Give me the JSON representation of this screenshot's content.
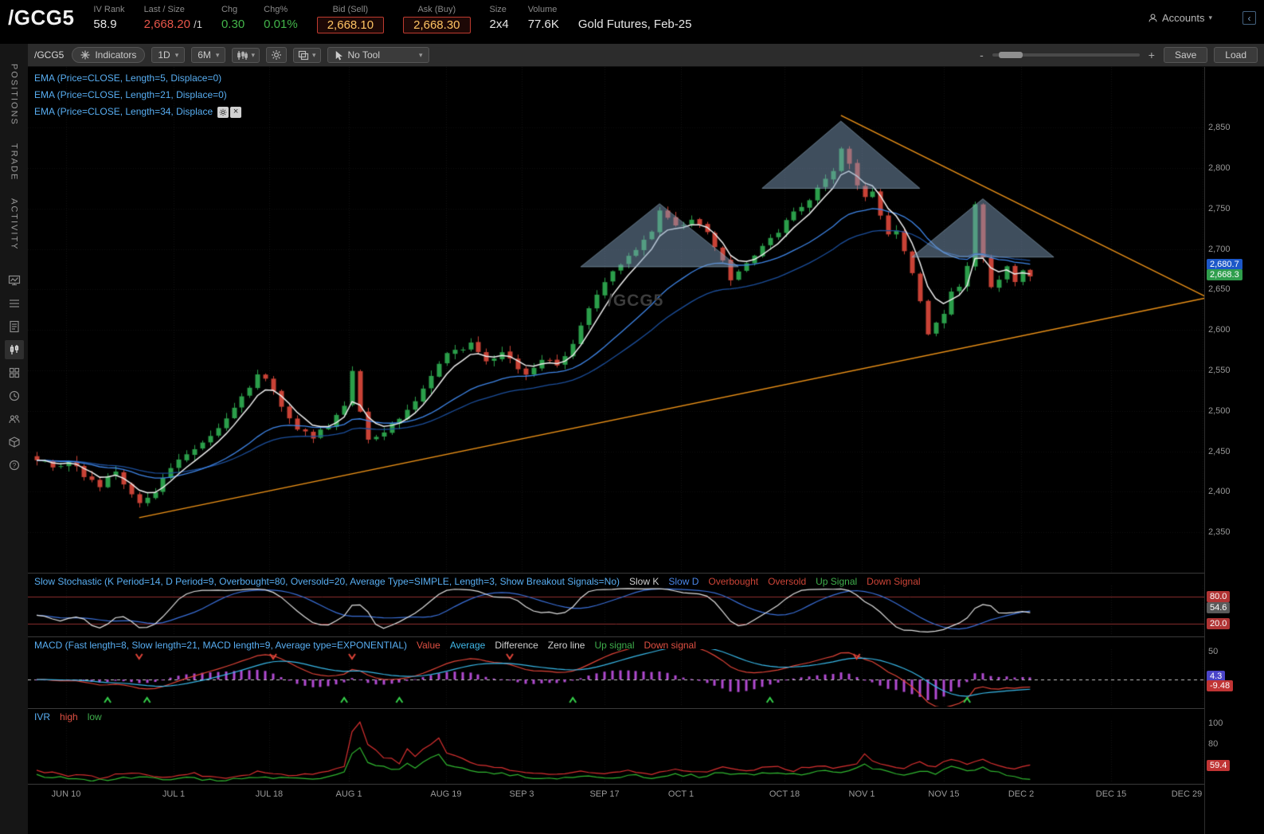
{
  "ui": {
    "caret": "▾",
    "collapse": "‹",
    "close": "×"
  },
  "header": {
    "symbol": "/GCG5",
    "iv_rank": {
      "label": "IV Rank",
      "value": "58.9"
    },
    "last_size": {
      "label": "Last / Size",
      "value": "2,668.20",
      "size": "/1"
    },
    "chg": {
      "label": "Chg",
      "value": "0.30"
    },
    "chg_pct": {
      "label": "Chg%",
      "value": "0.01%"
    },
    "bid": {
      "label": "Bid (Sell)",
      "value": "2,668.10"
    },
    "ask": {
      "label": "Ask (Buy)",
      "value": "2,668.30"
    },
    "size": {
      "label": "Size",
      "value": "2x4"
    },
    "volume": {
      "label": "Volume",
      "value": "77.6K"
    },
    "description": "Gold Futures, Feb-25",
    "accounts_label": "Accounts"
  },
  "sidebar": {
    "tabs": [
      {
        "label": "POSITIONS"
      },
      {
        "label": "TRADE"
      },
      {
        "label": "ACTIVITY"
      }
    ],
    "icons": [
      "monitor-chart",
      "watchlist",
      "notes",
      "chart",
      "apps-grid",
      "history-clock",
      "community",
      "products-box",
      "help"
    ]
  },
  "toolbar": {
    "symbol": "/GCG5",
    "indicators_label": "Indicators",
    "timeframe": "1D",
    "range": "6M",
    "tool_label": "No Tool",
    "zoom_minus": "-",
    "zoom_plus": "+",
    "save_label": "Save",
    "load_label": "Load"
  },
  "chart": {
    "studies": [
      "EMA (Price=CLOSE, Length=5, Displace=0)",
      "EMA (Price=CLOSE, Length=21, Displace=0)",
      "EMA (Price=CLOSE, Length=34, Displace"
    ],
    "watermark": "/GCG5",
    "price_axis_labels": [
      "2,850",
      "2,800",
      "2,750",
      "2,700",
      "2,650",
      "2,600",
      "2,550",
      "2,500",
      "2,450",
      "2,400",
      "2,350"
    ],
    "price_bubbles": [
      {
        "text": "2,680.7",
        "color": "#1c57c8",
        "price": 2680.7
      },
      {
        "text": "2,668.3",
        "color": "#2f9e4c",
        "price": 2668.3
      }
    ]
  },
  "chart_data": {
    "type": "candlestick",
    "symbol": "/GCG5",
    "title": "Gold Futures, Feb-25",
    "period": "1D",
    "range": "6M",
    "bars": 127,
    "price_min": 2300,
    "price_max": 2925,
    "up_color": "#2b9e4a",
    "down_color": "#c94236",
    "close_anchors": [
      [
        0,
        2442
      ],
      [
        2,
        2428
      ],
      [
        4,
        2438
      ],
      [
        6,
        2420
      ],
      [
        8,
        2408
      ],
      [
        10,
        2424
      ],
      [
        12,
        2400
      ],
      [
        13,
        2386
      ],
      [
        15,
        2402
      ],
      [
        18,
        2438
      ],
      [
        21,
        2462
      ],
      [
        24,
        2488
      ],
      [
        26,
        2515
      ],
      [
        28,
        2548
      ],
      [
        29,
        2538
      ],
      [
        31,
        2505
      ],
      [
        33,
        2478
      ],
      [
        35,
        2468
      ],
      [
        37,
        2482
      ],
      [
        39,
        2505
      ],
      [
        40,
        2552
      ],
      [
        41,
        2502
      ],
      [
        42,
        2462
      ],
      [
        44,
        2472
      ],
      [
        46,
        2492
      ],
      [
        48,
        2512
      ],
      [
        50,
        2542
      ],
      [
        52,
        2572
      ],
      [
        55,
        2582
      ],
      [
        57,
        2562
      ],
      [
        59,
        2572
      ],
      [
        62,
        2545
      ],
      [
        64,
        2566
      ],
      [
        66,
        2556
      ],
      [
        68,
        2584
      ],
      [
        70,
        2625
      ],
      [
        72,
        2662
      ],
      [
        74,
        2680
      ],
      [
        76,
        2702
      ],
      [
        78,
        2722
      ],
      [
        79,
        2748
      ],
      [
        81,
        2728
      ],
      [
        83,
        2736
      ],
      [
        85,
        2718
      ],
      [
        87,
        2688
      ],
      [
        88,
        2664
      ],
      [
        90,
        2682
      ],
      [
        92,
        2702
      ],
      [
        94,
        2722
      ],
      [
        96,
        2744
      ],
      [
        98,
        2762
      ],
      [
        100,
        2784
      ],
      [
        101,
        2798
      ],
      [
        102,
        2822
      ],
      [
        103,
        2802
      ],
      [
        105,
        2762
      ],
      [
        106,
        2768
      ],
      [
        107,
        2742
      ],
      [
        108,
        2716
      ],
      [
        109,
        2722
      ],
      [
        110,
        2698
      ],
      [
        111,
        2668
      ],
      [
        112,
        2632
      ],
      [
        113,
        2596
      ],
      [
        114,
        2612
      ],
      [
        115,
        2622
      ],
      [
        116,
        2644
      ],
      [
        117,
        2656
      ],
      [
        118,
        2678
      ],
      [
        119,
        2756
      ],
      [
        120,
        2688
      ],
      [
        121,
        2652
      ],
      [
        122,
        2662
      ],
      [
        123,
        2676
      ],
      [
        124,
        2660
      ],
      [
        125,
        2672
      ],
      [
        126,
        2668
      ]
    ],
    "ema_lengths": [
      5,
      21,
      34
    ],
    "ema_colors": [
      "#eeeeee",
      "#3f86e8",
      "#1c4f9c"
    ],
    "trendlines": [
      {
        "from": [
          13,
          2368
        ],
        "to": [
          148.5,
          2640
        ],
        "color": "#f09418"
      },
      {
        "from": [
          102,
          2865
        ],
        "to": [
          148.5,
          2640
        ],
        "color": "#f09418"
      }
    ],
    "triangles": [
      {
        "points": [
          [
            69,
            2678
          ],
          [
            89,
            2678
          ],
          [
            79,
            2756
          ]
        ]
      },
      {
        "points": [
          [
            92,
            2775
          ],
          [
            112,
            2775
          ],
          [
            102,
            2858
          ]
        ]
      },
      {
        "points": [
          [
            111,
            2690
          ],
          [
            129,
            2690
          ],
          [
            120,
            2762
          ]
        ]
      }
    ],
    "triangle_fill": "rgba(125,155,185,0.5)"
  },
  "stoch": {
    "title": "Slow Stochastic (K Period=14, D Period=9, Overbought=80, Oversold=20, Average Type=SIMPLE, Length=3, Show Breakout Signals=No)",
    "legend": [
      {
        "text": "Slow K",
        "color": "#d0d0d0"
      },
      {
        "text": "Slow D",
        "color": "#4a86e8"
      },
      {
        "text": "Overbought",
        "color": "#cc4437"
      },
      {
        "text": "Oversold",
        "color": "#cc4437"
      },
      {
        "text": "Up Signal",
        "color": "#3fae4c"
      },
      {
        "text": "Down Signal",
        "color": "#cc4437"
      }
    ],
    "overbought": 80,
    "oversold": 20,
    "axis_values": [
      {
        "text": "80.0",
        "bg": "#b03434",
        "v": 80
      },
      {
        "text": "54.6",
        "bg": "#5a5a5a",
        "v": 54.6
      },
      {
        "text": "20.0",
        "bg": "#b03434",
        "v": 20
      }
    ]
  },
  "macd": {
    "title": "MACD (Fast length=8, Slow length=21, MACD length=9, Average type=EXPONENTIAL)",
    "legend": [
      {
        "text": "Value",
        "color": "#e05043"
      },
      {
        "text": "Average",
        "color": "#40b8e8"
      },
      {
        "text": "Difference",
        "color": "#d0d0d0"
      },
      {
        "text": "Zero line",
        "color": "#d0d0d0"
      },
      {
        "text": "Up signal",
        "color": "#3fae4c"
      },
      {
        "text": "Down signal",
        "color": "#e05043"
      }
    ],
    "axis_top": "50",
    "axis_values": [
      {
        "text": "4.3",
        "bg": "#4a44c8",
        "v": 4.3
      },
      {
        "text": "-9.48",
        "bg": "#c03434",
        "v": -9.48
      }
    ],
    "up_signal_bars": [
      9,
      14,
      39,
      46,
      68,
      93,
      118
    ],
    "down_signal_bars": [
      13,
      30,
      40,
      60,
      104
    ]
  },
  "ivr": {
    "title": "IVR",
    "legend": [
      {
        "text": "high",
        "color": "#e05043"
      },
      {
        "text": "low",
        "color": "#3fae4c"
      }
    ],
    "axis_labels": [
      {
        "text": "100",
        "v": 100
      },
      {
        "text": "80",
        "v": 80
      }
    ],
    "value_bubble": {
      "text": "59.4",
      "bg": "#c03434",
      "v": 59.4
    },
    "high_anchors": [
      [
        0,
        55
      ],
      [
        4,
        50
      ],
      [
        8,
        48
      ],
      [
        12,
        52
      ],
      [
        16,
        49
      ],
      [
        20,
        51
      ],
      [
        24,
        48
      ],
      [
        28,
        53
      ],
      [
        32,
        50
      ],
      [
        36,
        52
      ],
      [
        39,
        58
      ],
      [
        40,
        92
      ],
      [
        41,
        102
      ],
      [
        42,
        80
      ],
      [
        44,
        68
      ],
      [
        46,
        62
      ],
      [
        47,
        74
      ],
      [
        48,
        68
      ],
      [
        50,
        80
      ],
      [
        51,
        86
      ],
      [
        52,
        72
      ],
      [
        54,
        65
      ],
      [
        56,
        60
      ],
      [
        58,
        58
      ],
      [
        60,
        55
      ],
      [
        63,
        52
      ],
      [
        66,
        50
      ],
      [
        69,
        54
      ],
      [
        72,
        51
      ],
      [
        75,
        55
      ],
      [
        78,
        52
      ],
      [
        81,
        56
      ],
      [
        84,
        53
      ],
      [
        87,
        57
      ],
      [
        90,
        54
      ],
      [
        93,
        58
      ],
      [
        96,
        55
      ],
      [
        99,
        60
      ],
      [
        102,
        57
      ],
      [
        104,
        62
      ],
      [
        105,
        70
      ],
      [
        106,
        64
      ],
      [
        108,
        60
      ],
      [
        110,
        57
      ],
      [
        112,
        62
      ],
      [
        114,
        58
      ],
      [
        116,
        65
      ],
      [
        118,
        60
      ],
      [
        120,
        66
      ],
      [
        122,
        60
      ],
      [
        124,
        56
      ],
      [
        126,
        59
      ]
    ],
    "low_anchors": [
      [
        0,
        50
      ],
      [
        4,
        47
      ],
      [
        8,
        45
      ],
      [
        12,
        48
      ],
      [
        16,
        46
      ],
      [
        20,
        47
      ],
      [
        24,
        45
      ],
      [
        28,
        48
      ],
      [
        32,
        46
      ],
      [
        36,
        47
      ],
      [
        39,
        52
      ],
      [
        40,
        70
      ],
      [
        41,
        76
      ],
      [
        42,
        62
      ],
      [
        44,
        58
      ],
      [
        46,
        55
      ],
      [
        47,
        62
      ],
      [
        48,
        58
      ],
      [
        50,
        66
      ],
      [
        51,
        70
      ],
      [
        52,
        60
      ],
      [
        54,
        56
      ],
      [
        56,
        53
      ],
      [
        58,
        52
      ],
      [
        60,
        50
      ],
      [
        63,
        48
      ],
      [
        66,
        47
      ],
      [
        69,
        49
      ],
      [
        72,
        47
      ],
      [
        75,
        50
      ],
      [
        78,
        48
      ],
      [
        81,
        51
      ],
      [
        84,
        49
      ],
      [
        87,
        52
      ],
      [
        90,
        50
      ],
      [
        93,
        52
      ],
      [
        96,
        50
      ],
      [
        99,
        54
      ],
      [
        102,
        52
      ],
      [
        104,
        56
      ],
      [
        105,
        60
      ],
      [
        106,
        56
      ],
      [
        108,
        53
      ],
      [
        110,
        51
      ],
      [
        112,
        55
      ],
      [
        114,
        52
      ],
      [
        116,
        58
      ],
      [
        118,
        54
      ],
      [
        120,
        57
      ],
      [
        122,
        52
      ],
      [
        124,
        48
      ],
      [
        126,
        46
      ]
    ]
  },
  "time_axis": [
    {
      "text": "JUN 10",
      "f": 0.0325
    },
    {
      "text": "JUL 1",
      "f": 0.1239
    },
    {
      "text": "JUL 18",
      "f": 0.2051
    },
    {
      "text": "AUG 1",
      "f": 0.2729
    },
    {
      "text": "AUG 19",
      "f": 0.3554
    },
    {
      "text": "SEP 3",
      "f": 0.4198
    },
    {
      "text": "SEP 17",
      "f": 0.4902
    },
    {
      "text": "OCT 1",
      "f": 0.5552
    },
    {
      "text": "OCT 18",
      "f": 0.6432
    },
    {
      "text": "NOV 1",
      "f": 0.7089
    },
    {
      "text": "NOV 15",
      "f": 0.7786
    },
    {
      "text": "DEC 2",
      "f": 0.8443
    },
    {
      "text": "DEC 15",
      "f": 0.9208
    },
    {
      "text": "DEC 29",
      "f": 0.9986
    }
  ]
}
